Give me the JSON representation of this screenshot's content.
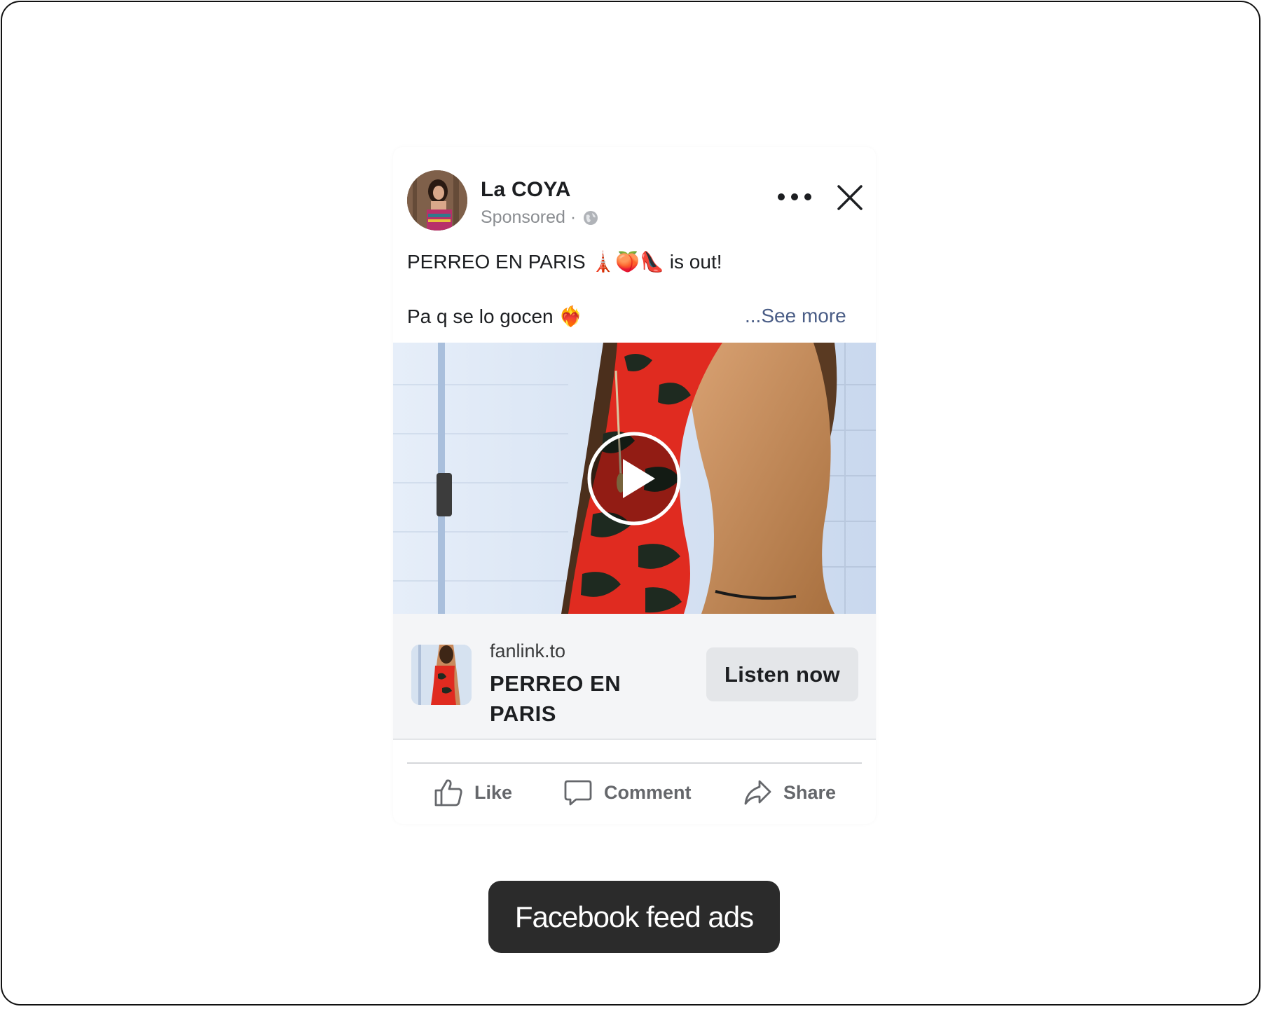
{
  "caption": "Facebook feed ads",
  "post": {
    "page_name": "La COYA",
    "sponsored_label": "Sponsored ·",
    "text_line_1": "PERREO EN PARIS 🗼🍑👠 is out!",
    "text_line_2": "Pa q se lo gocen ❤️‍🔥",
    "see_more_label": "...See more",
    "more_options_icon": "ellipsis-icon",
    "close_icon": "close-icon",
    "privacy_icon": "globe-icon"
  },
  "media": {
    "type": "video",
    "play_icon": "play-icon"
  },
  "link_preview": {
    "domain": "fanlink.to",
    "title": "PERREO EN PARIS",
    "cta_label": "Listen now"
  },
  "actions": [
    {
      "label": "Like",
      "icon": "thumbs-up-icon"
    },
    {
      "label": "Comment",
      "icon": "comment-icon"
    },
    {
      "label": "Share",
      "icon": "share-icon"
    }
  ],
  "colors": {
    "see_more": "#4a5d86",
    "action_gray": "#65676b",
    "link_bar_bg": "#f4f5f7",
    "cta_bg": "#e4e6e9",
    "caption_bg": "#2b2b2b"
  }
}
